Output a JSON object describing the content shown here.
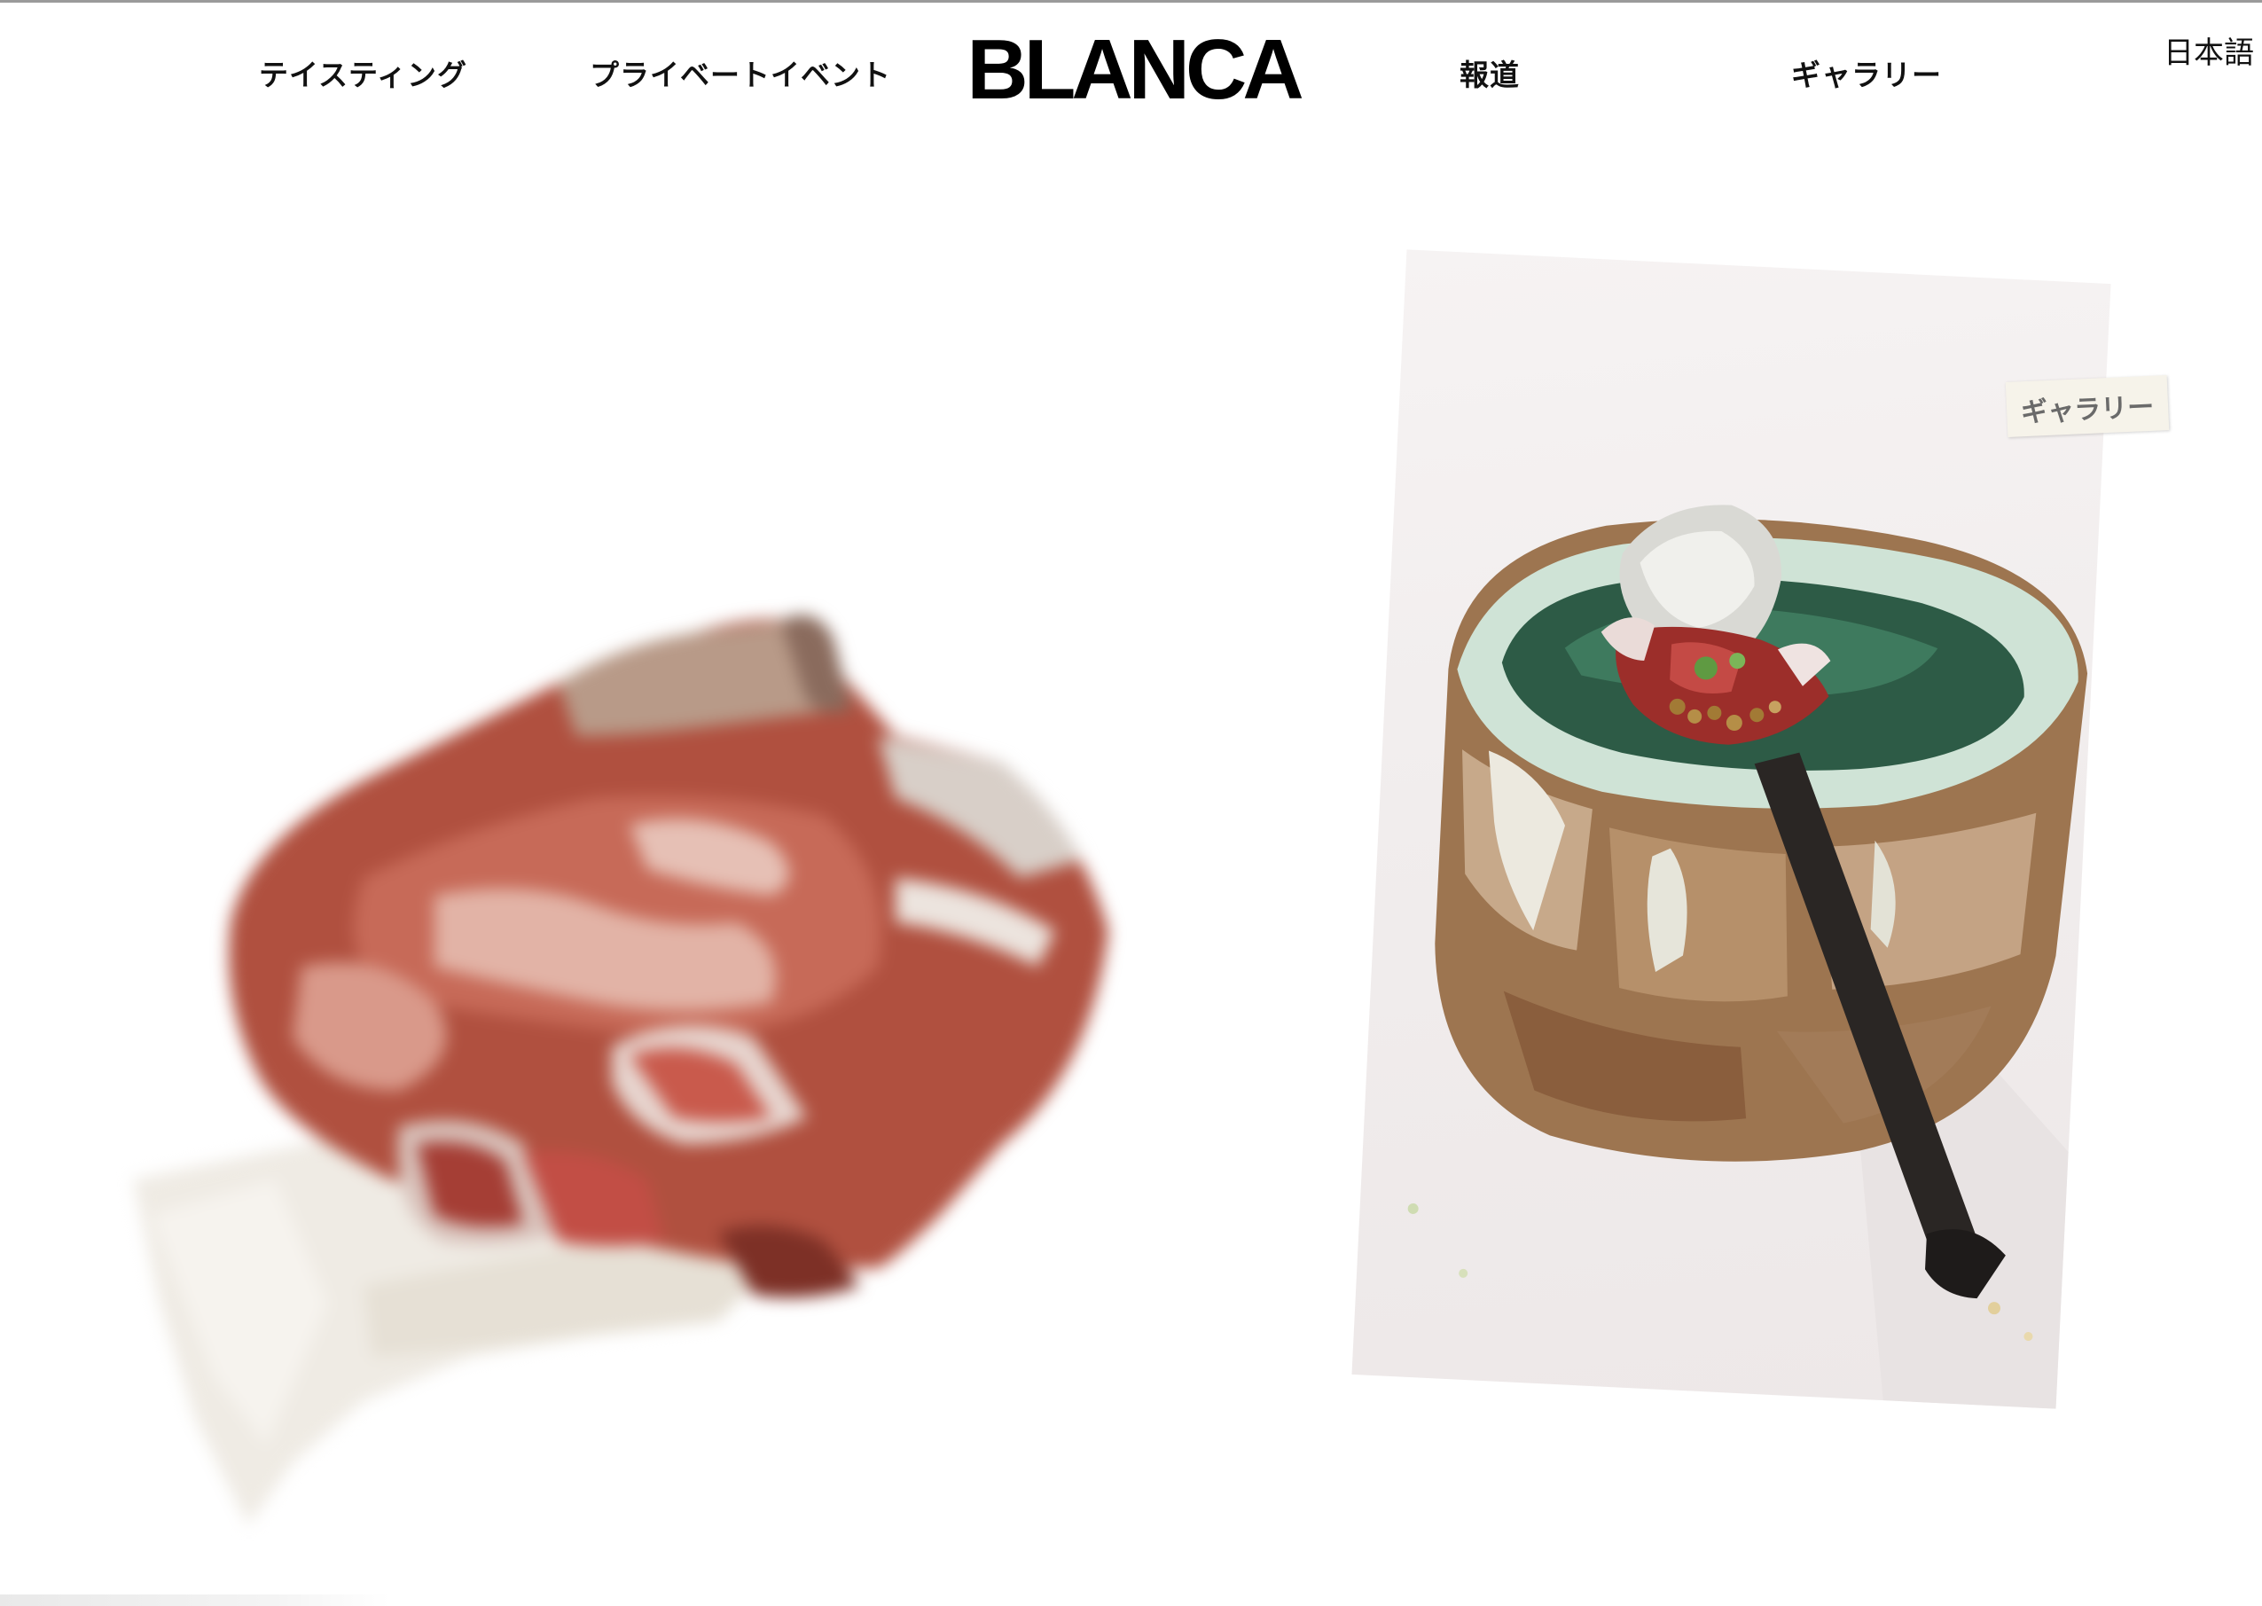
{
  "header": {
    "nav_left": [
      {
        "id": "tasting",
        "label": "テイスティング"
      },
      {
        "id": "private_events",
        "label": "プライベートイベント"
      }
    ],
    "logo_text": "BLANCA",
    "nav_right": [
      {
        "id": "press",
        "label": "報道"
      },
      {
        "id": "gallery",
        "label": "ギャラリー"
      }
    ],
    "language": "日本語"
  },
  "hero": {
    "left_image": "blurred dry-aged ribeye on the bone with linen napkin",
    "right_image": "green glazed ceramic bowl with spoon of beet, chili and mustard seeds",
    "right_tag_label": "ギャラリー"
  },
  "colors": {
    "background": "#ffffff",
    "text": "#111111",
    "tag_background": "#f6f3ea",
    "tag_text": "#6a6a6a"
  }
}
